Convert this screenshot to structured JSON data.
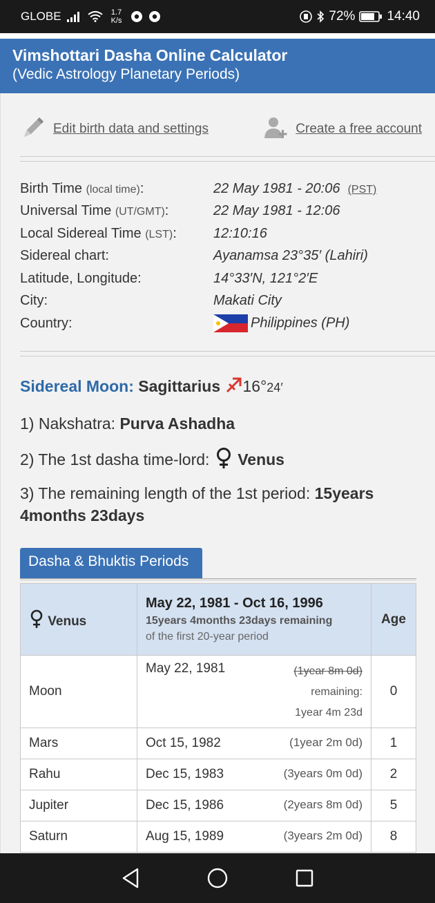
{
  "status_bar": {
    "carrier": "GLOBE",
    "net_speed_value": "1.7",
    "net_speed_unit": "K/s",
    "battery": "72%",
    "time": "14:40"
  },
  "header": {
    "title": "Vimshottari Dasha Online Calculator",
    "subtitle": "(Vedic Astrology Planetary Periods)"
  },
  "links": {
    "edit": "Edit birth data and settings",
    "create": "Create a free account"
  },
  "birth_info": {
    "birth_time_label": "Birth Time ",
    "birth_time_note": "(local time)",
    "birth_time_colon": ":",
    "birth_time_value": "22 May 1981 - 20:06",
    "birth_time_tz": "(PST)",
    "ut_label": "Universal Time ",
    "ut_note": "(UT/GMT)",
    "ut_colon": ":",
    "ut_value": "22 May 1981 - 12:06",
    "lst_label": "Local Sidereal Time ",
    "lst_note": "(LST)",
    "lst_colon": ":",
    "lst_value": "12:10:16",
    "sidereal_label": "Sidereal chart:",
    "sidereal_value": "Ayanamsa 23°35′ (Lahiri)",
    "latlong_label": "Latitude, Longitude:",
    "latlong_value": "14°33′N, 121°2′E",
    "city_label": "City:",
    "city_value": "Makati City",
    "country_label": "Country:",
    "country_value": "Philippines (PH)"
  },
  "moon": {
    "label": "Sidereal Moon:",
    "sign": "Sagittarius",
    "degree": "16°",
    "minute": "24′"
  },
  "nakshatra": {
    "prefix": "1) Nakshatra: ",
    "value": "Purva Ashadha"
  },
  "lord": {
    "prefix": "2) The 1st dasha time-lord: ",
    "value": "Venus"
  },
  "remaining": {
    "prefix": "3) The remaining length of the 1st period: ",
    "value": "15years 4months 23days"
  },
  "tab": {
    "label": "Dasha & Bhuktis Periods"
  },
  "table": {
    "planet": "Venus",
    "period": "May 22, 1981 - Oct 16, 1996",
    "remaining": "15years 4months 23days remaining",
    "of_first": "of the first 20-year period",
    "age_header": "Age",
    "moon_row": {
      "planet": "Moon",
      "date": "May 22, 1981",
      "struck_duration": "(1year 8m 0d)",
      "remaining_label": "remaining:",
      "remaining_value": "1year 4m 23d",
      "age": "0"
    },
    "rows": [
      {
        "planet": "Mars",
        "date": "Oct 15, 1982",
        "duration": "(1year 2m 0d)",
        "age": "1"
      },
      {
        "planet": "Rahu",
        "date": "Dec 15, 1983",
        "duration": "(3years 0m 0d)",
        "age": "2"
      },
      {
        "planet": "Jupiter",
        "date": "Dec 15, 1986",
        "duration": "(2years 8m 0d)",
        "age": "5"
      },
      {
        "planet": "Saturn",
        "date": "Aug 15, 1989",
        "duration": "(3years 2m 0d)",
        "age": "8"
      }
    ]
  },
  "colors": {
    "header_bg": "#3b72b5",
    "moon_label": "#2d6aa8",
    "sagittarius_symbol": "#d9372f",
    "table_header_bg": "#d4e1f1"
  }
}
